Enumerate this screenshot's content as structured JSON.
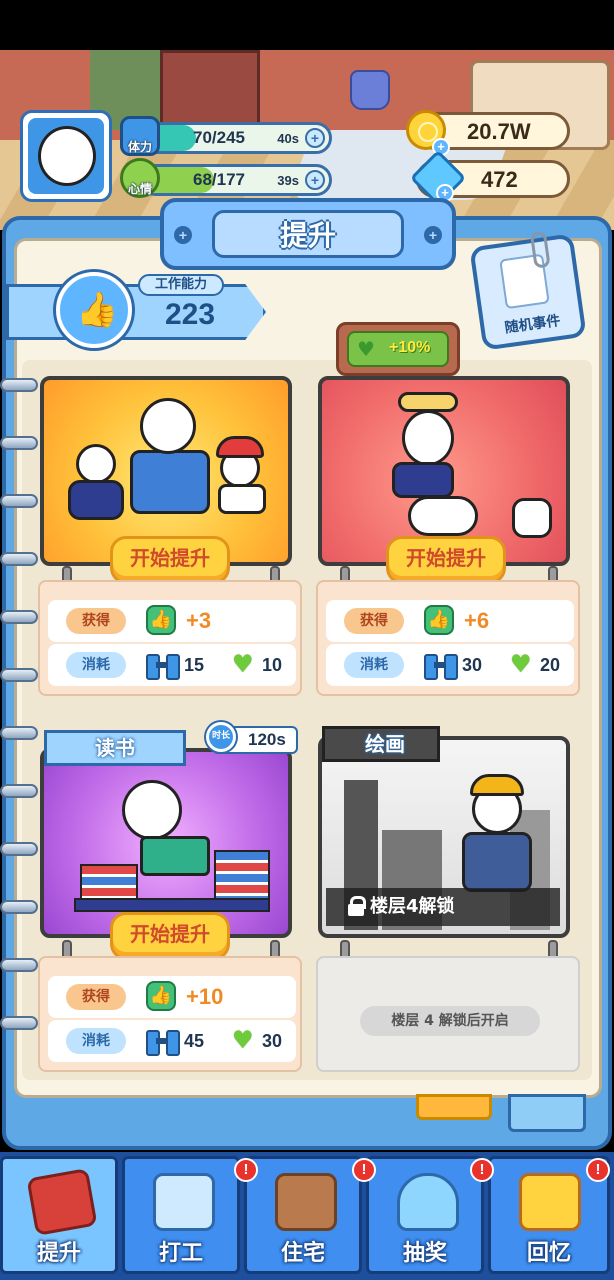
{
  "player": {
    "stamina": {
      "label": "体力",
      "value": "70/245",
      "timer": "40s",
      "fill": 0.286
    },
    "mood": {
      "label": "心情",
      "value": "68/177",
      "timer": "39s",
      "fill": 0.384
    }
  },
  "currency": {
    "coins": "20.7W",
    "gems": "472"
  },
  "panel": {
    "title": "提升",
    "ability_label": "工作能力",
    "ability_value": "223",
    "random_event": "随机事件",
    "bonus": "+10%"
  },
  "cards": [
    {
      "id": "card-1",
      "start_label": "开始提升",
      "gain_label": "获得",
      "gain_value": "+3",
      "cost_label": "消耗",
      "cost_stamina": "15",
      "cost_mood": "10"
    },
    {
      "id": "card-2",
      "start_label": "开始提升",
      "gain_label": "获得",
      "gain_value": "+6",
      "cost_label": "消耗",
      "cost_stamina": "30",
      "cost_mood": "20"
    },
    {
      "id": "card-3",
      "title": "读书",
      "duration_label": "时长",
      "duration": "120s",
      "start_label": "开始提升",
      "gain_label": "获得",
      "gain_value": "+10",
      "cost_label": "消耗",
      "cost_stamina": "45",
      "cost_mood": "30"
    },
    {
      "id": "card-4",
      "title": "绘画",
      "lock_text": "楼层4解锁",
      "locked_message": "楼层 4 解锁后开启"
    }
  ],
  "nav": [
    {
      "label": "提升",
      "icon": "book-icon",
      "active": true,
      "alert": false
    },
    {
      "label": "打工",
      "icon": "monitor-icon",
      "active": false,
      "alert": true
    },
    {
      "label": "住宅",
      "icon": "house-icon",
      "active": false,
      "alert": true
    },
    {
      "label": "抽奖",
      "icon": "gacha-icon",
      "active": false,
      "alert": true
    },
    {
      "label": "回忆",
      "icon": "camera-icon",
      "active": false,
      "alert": true
    }
  ],
  "alert_symbol": "!",
  "colors": {
    "primary_blue": "#3f8ef0",
    "button_yellow": "#ffd23f",
    "stamina_teal": "#36c7b4",
    "mood_green": "#8fd14f",
    "alert_red": "#e8322b"
  }
}
